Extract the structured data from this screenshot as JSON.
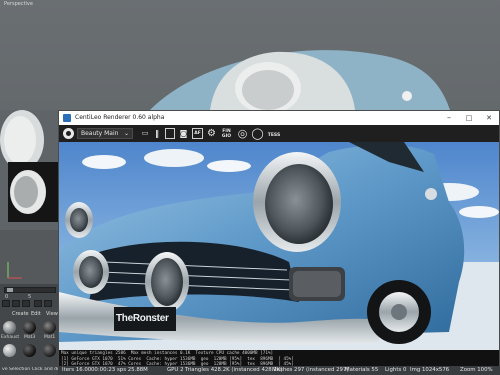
{
  "viewport": {
    "label": "Perspective"
  },
  "left_panel": {
    "slider_min": "0",
    "slider_max": "5",
    "menu": [
      "Create",
      "Edit",
      "View"
    ],
    "materials": [
      {
        "name": "Exhaust",
        "color": "#8a8d90"
      },
      {
        "name": "Mat3",
        "color": "#1a1a1a"
      },
      {
        "name": "Mat1",
        "color": "#2a2a2a"
      },
      {
        "name": "",
        "color": "#b9bcbe"
      },
      {
        "name": "",
        "color": "#222222"
      },
      {
        "name": "",
        "color": "#333333"
      }
    ],
    "status": "ve Selection   Click and drag"
  },
  "renderer": {
    "title": "CentiLeo Renderer 0.60 alpha",
    "window_buttons": {
      "minimize": "–",
      "maximize": "□",
      "close": "✕"
    },
    "toolbar": {
      "camera": "Beauty Main",
      "buttons": [
        "pause-icon",
        "stop-icon",
        "camera-icon",
        "af-icon",
        "settings-icon",
        "fin-gi-icon",
        "exposure-icon",
        "tess-icon"
      ],
      "af_label": "AF",
      "fin_gi_label": "FIN GIO",
      "tess_label": "TESS"
    },
    "render": {
      "sky_color": "#5b8fd0",
      "car_color": "#6ea4d0",
      "plate_text": "TheRonster"
    },
    "log": [
      "Max unique triangles 2586  Max mesh instances 0.1K  Texture CPU cache 4000MB [71%]",
      "[1] GeForce GTX 1070  51% Cores  Cache: hyper 1536MB  geo  128MB [95%]  tex  896MB  [ 45%]",
      "[2] GeForce GTX 1070  47% Cores  Cache: hyper 1536MB  geo  128MB [95%]  tex  896MB  [ 45%]"
    ]
  },
  "status": {
    "iters": "Iters 16.00",
    "time": "00:00:23",
    "sps": "sps 25.88M",
    "gpu": "GPU 2",
    "triangles": "Triangles 428.2K (instanced 428.2K)",
    "meshes": "Meshes 297 (instanced 297)",
    "materials": "Materials 55",
    "lights": "Lights 0",
    "img": "Img 1024x576",
    "zoom": "Zoom 100%"
  }
}
